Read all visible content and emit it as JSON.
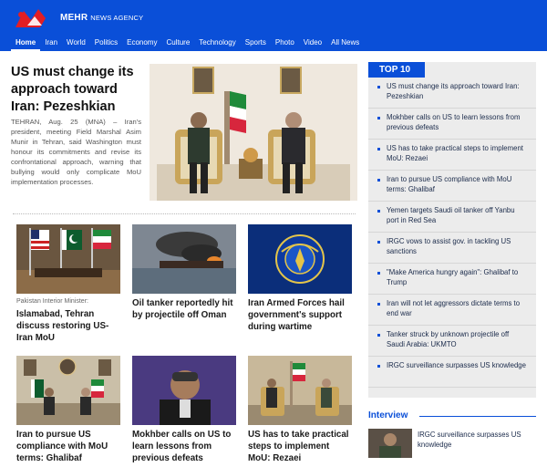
{
  "header": {
    "brand_name": "MEHR",
    "brand_suffix": "NEWS AGENCY",
    "nav": [
      "Home",
      "Iran",
      "World",
      "Politics",
      "Economy",
      "Culture",
      "Technology",
      "Sports",
      "Photo",
      "Video",
      "All News"
    ]
  },
  "hero": {
    "title": "US must change its approach toward Iran: Pezeshkian",
    "summary": "TEHRAN, Aug. 25 (MNA) – Iran's president, meeting Field Marshal Asim Munir in Tehran, said Washington must honour its commitments and revise its confrontational approach, warning that bullying would only complicate MoU implementation processes."
  },
  "cards": [
    {
      "kicker": "Pakistan Interior Minister:",
      "title": "Islamabad, Tehran discuss restoring US-Iran MoU"
    },
    {
      "kicker": "",
      "title": "Oil tanker reportedly hit by projectile off Oman"
    },
    {
      "kicker": "",
      "title": "Iran Armed Forces hail government's support during wartime"
    },
    {
      "kicker": "",
      "title": "Iran to pursue US compliance with MoU terms: Ghalibaf"
    },
    {
      "kicker": "",
      "title": "Mokhber calls on US to learn lessons from previous defeats"
    },
    {
      "kicker": "",
      "title": "US has to take practical steps to implement MoU: Rezaei"
    }
  ],
  "top10": {
    "heading": "TOP 10",
    "items": [
      "US must change its approach toward Iran: Pezeshkian",
      "Mokhber calls on US to learn lessons from previous defeats",
      "US has to take practical steps to implement MoU: Rezaei",
      "Iran to pursue US compliance with MoU terms: Ghalibaf",
      "Yemen targets Saudi oil tanker off Yanbu port in Red Sea",
      "IRGC vows to assist gov. in tackling US sanctions",
      "\"Make America hungry again\": Ghalibaf to Trump",
      "Iran will not let aggressors dictate terms to end war",
      "Tanker struck by unknown projectile off Saudi Arabia: UKMTO",
      "IRGC surveillance surpasses US knowledge"
    ]
  },
  "interview": {
    "heading": "Interview",
    "item_title": "IRGC surveillance surpasses US knowledge"
  },
  "colors": {
    "brand_blue": "#0a4fd8",
    "sidebar_bg": "#ececec",
    "logo_red": "#e31e24"
  }
}
